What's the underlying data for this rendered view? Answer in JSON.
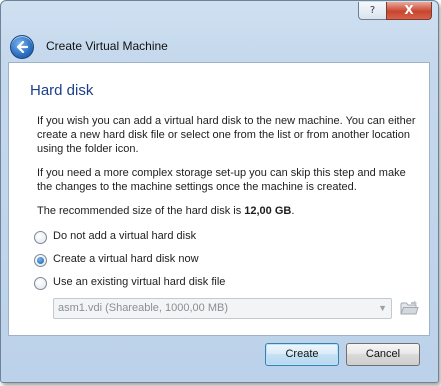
{
  "window": {
    "help_glyph": "?",
    "close_glyph": "X"
  },
  "header": {
    "title": "Create Virtual Machine"
  },
  "page": {
    "title": "Hard disk",
    "paragraph1": "If you wish you can add a virtual hard disk to the new machine. You can either create a new hard disk file or select one from the list or from another location using the folder icon.",
    "paragraph2": "If you need a more complex storage set-up you can skip this step and make the changes to the machine settings once the machine is created.",
    "recommended_prefix": "The recommended size of the hard disk is ",
    "recommended_size": "12,00 GB",
    "recommended_suffix": "."
  },
  "options": [
    {
      "label": "Do not add a virtual hard disk",
      "checked": false
    },
    {
      "label": "Create a virtual hard disk now",
      "checked": true
    },
    {
      "label": "Use an existing virtual hard disk file",
      "checked": false
    }
  ],
  "existing_disk": {
    "selected": "asm1.vdi (Shareable, 1000,00 MB)",
    "enabled": false
  },
  "buttons": {
    "create": "Create",
    "cancel": "Cancel"
  },
  "icons": {
    "back": "back-arrow-icon",
    "folder": "folder-icon",
    "dropdown": "chevron-down-icon"
  }
}
